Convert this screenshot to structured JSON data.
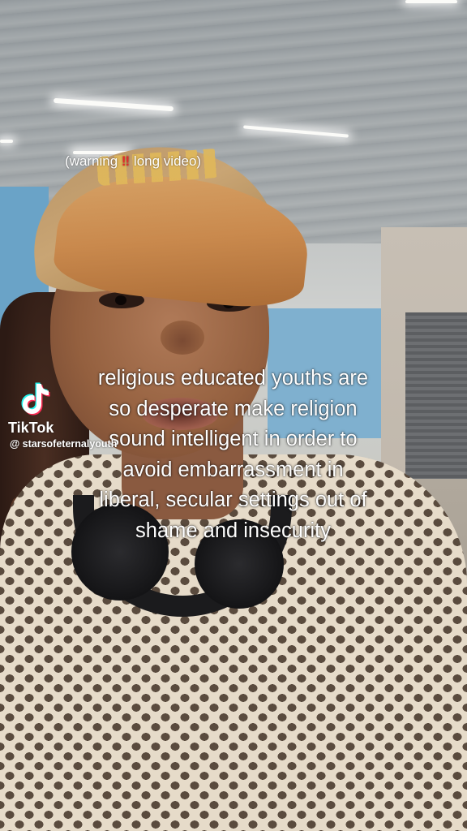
{
  "overlay": {
    "warning_prefix": "(warning ",
    "warning_emoji": "‼",
    "warning_suffix": " long video)",
    "caption_lines": [
      "religious educated youths are",
      "so desperate make religion",
      "sound intelligent in order to",
      "avoid embarrassment in",
      "liberal, secular settings out of",
      "shame and insecurity"
    ]
  },
  "watermark": {
    "logo_icon": "tiktok-note-icon",
    "brand": "TikTok",
    "handle": "@ starsofeternalyouth"
  },
  "colors": {
    "caption_text": "#ffffff",
    "warning_emoji": "#e32b2b",
    "tiktok_cyan": "#25f4ee",
    "tiktok_red": "#fe2c55"
  }
}
